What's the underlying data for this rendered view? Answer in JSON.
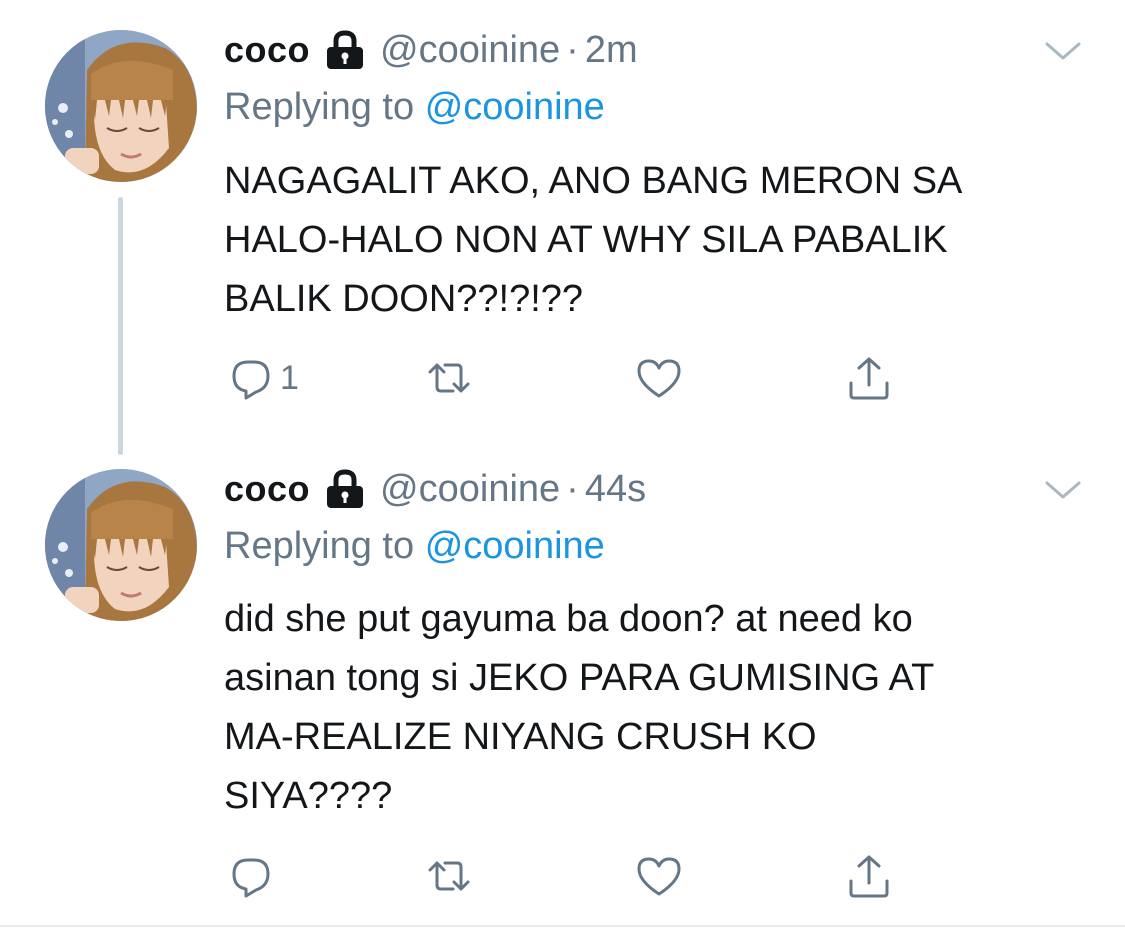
{
  "tweets": [
    {
      "display_name": "coco",
      "handle": "@cooinine",
      "separator": "·",
      "time": "2m",
      "replying_prefix": "Replying to",
      "replying_to": "@cooinine",
      "lines": [
        "NAGAGALIT AKO, ANO BANG MERON SA",
        "HALO-HALO NON AT WHY SILA PABALIK",
        "BALIK DOON??!?!??"
      ],
      "reply_count": "1"
    },
    {
      "display_name": "coco",
      "handle": "@cooinine",
      "separator": "·",
      "time": "44s",
      "replying_prefix": "Replying to",
      "replying_to": "@cooinine",
      "lines": [
        "did she put gayuma ba doon? at need ko",
        "asinan tong si JEKO PARA GUMISING AT",
        "MA-REALIZE NIYANG CRUSH KO",
        "SIYA????"
      ],
      "reply_count": ""
    }
  ],
  "icons": {
    "protected": "lock-icon",
    "menu": "chevron-down-icon",
    "reply": "reply-icon",
    "retweet": "retweet-icon",
    "like": "heart-icon",
    "share": "share-icon"
  },
  "colors": {
    "text": "#14171a",
    "secondary": "#657786",
    "link": "#1b95e0",
    "thread_line": "#ccd6dd"
  }
}
